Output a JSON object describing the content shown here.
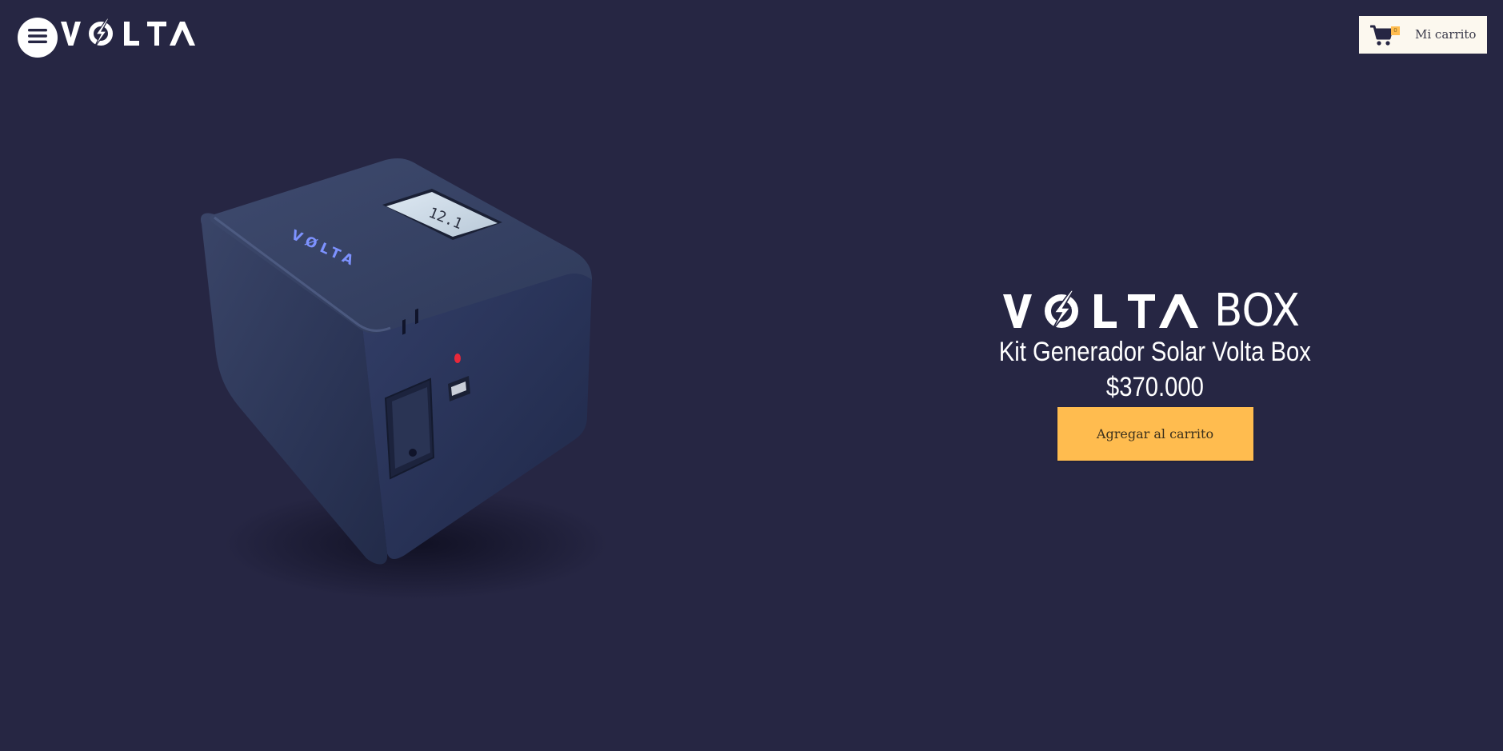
{
  "header": {
    "menu_icon": "hamburger-icon",
    "logo_text": "VØLTA",
    "cart": {
      "icon": "cart-icon",
      "count": "0",
      "label": "Mi carrito"
    }
  },
  "product": {
    "brand_logo_text": "VØLTA",
    "brand_suffix": "BOX",
    "title": "Kit Generador Solar Volta Box",
    "price": "$370.000",
    "add_to_cart_label": "Agregar al carrito",
    "image": {
      "display_text": "12.1",
      "logo_text": "VØLTA"
    }
  },
  "colors": {
    "background": "#262643",
    "accent": "#ffbc4f",
    "cart_bg": "#fcf8ef",
    "text": "#ffffff"
  }
}
